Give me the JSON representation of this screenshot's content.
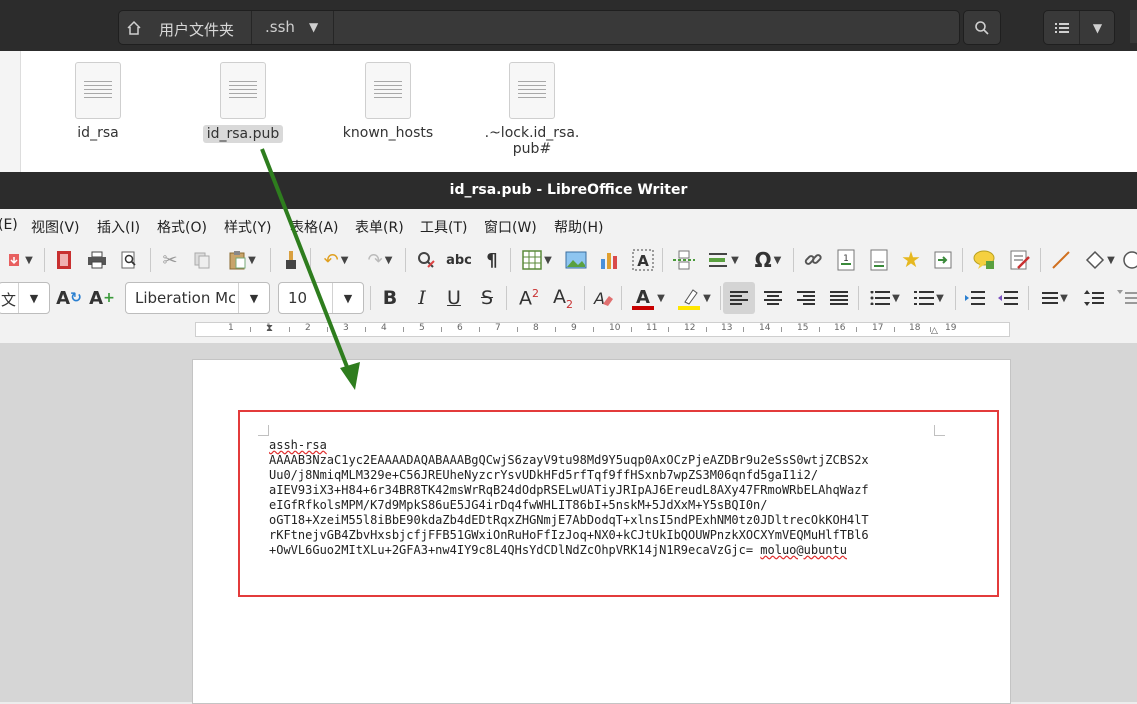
{
  "file_manager": {
    "path_home": "用户文件夹",
    "path_current": ".ssh",
    "files": [
      {
        "name": "id_rsa",
        "selected": false
      },
      {
        "name": "id_rsa.pub",
        "selected": true
      },
      {
        "name": "known_hosts",
        "selected": false
      },
      {
        "name_line1": ".~lock.id_rsa.",
        "name_line2": "pub#",
        "selected": false
      }
    ]
  },
  "writer": {
    "title": "id_rsa.pub - LibreOffice Writer",
    "menu": [
      "(E)",
      "视图(V)",
      "插入(I)",
      "格式(O)",
      "样式(Y)",
      "表格(A)",
      "表单(R)",
      "工具(T)",
      "窗口(W)",
      "帮助(H)"
    ],
    "style_combo": "文",
    "font_name": "Liberation Mc",
    "font_size": "10",
    "ruler_numbers": [
      "1",
      "1",
      "2",
      "3",
      "4",
      "5",
      "6",
      "7",
      "8",
      "9",
      "10",
      "11",
      "12",
      "13",
      "14",
      "15",
      "16",
      "17",
      "18",
      "19"
    ],
    "document_lines": [
      "assh-rsa",
      "AAAAB3NzaC1yc2EAAAADAQABAAABgQCwjS6zayV9tu98Md9Y5uqp0AxOCzPjeAZDBr9u2eSsS0wtjZCBS2x",
      "Uu0/j8NmiqMLM329e+C56JREUheNyzcrYsvUDkHFd5rfTqf9ffHSxnb7wpZS3M06qnfd5gaI1i2/",
      "aIEV93iX3+H84+6r34BR8TK42msWrRqB24dOdpRSELwUATiyJRIpAJ6EreudL8AXy47FRmoWRbELAhqWazf",
      "eIGfRfkolsMPM/K7d9MpkS86uE5JG4irDq4fwWHLIT86bI+5nskM+5JdXxM+Y5sBQI0n/",
      "oGT18+XzeiM55l8iBbE90kdaZb4dEDtRqxZHGNmjE7AbDodqT+xlnsI5ndPExhNM0tz0JDltrecOkKOH4lT",
      "rKFtnejvGB4ZbvHxsbjcfjFFB51GWxiOnRuHoFfIzJoq+NX0+kCJtUkIbQOUWPnzkXOCXYmVEQMuHlfTBl6",
      "+OwVL6Guo2MItXLu+2GFA3+nw4IY9c8L4QHsYdCDlNdZcOhpVRK14jN1R9ecaVzGjc= "
    ],
    "last_line_user": "moluo@ubuntu"
  },
  "colors": {
    "annotation_red": "#e33b3b",
    "arrow_green": "#2e7d1e",
    "dark_header": "#2c2c2c"
  }
}
